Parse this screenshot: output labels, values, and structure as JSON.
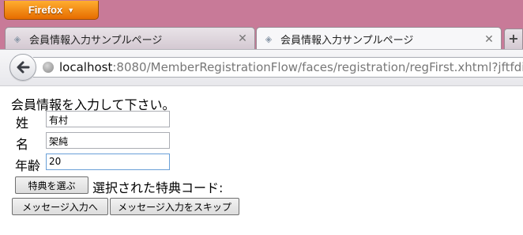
{
  "browser": {
    "app_button": "Firefox",
    "tabs": [
      {
        "title": "会員情報入力サンプルページ",
        "active": false
      },
      {
        "title": "会員情報入力サンプルページ",
        "active": true
      }
    ],
    "new_tab_symbol": "+",
    "url": {
      "host": "localhost",
      "rest": ":8080/MemberRegistrationFlow/faces/registration/regFirst.xhtml?jftfdi"
    }
  },
  "form": {
    "heading": "会員情報を入力して下さい。",
    "last_name": {
      "label": "姓",
      "value": "有村"
    },
    "first_name": {
      "label": "名",
      "value": "架純"
    },
    "age": {
      "label": "年齢",
      "value": "20"
    },
    "choose_benefit_button": "特典を選ぶ",
    "selected_code_label": "選択された特典コード:",
    "to_message_button": "メッセージ入力へ",
    "skip_message_button": "メッセージ入力をスキップ"
  },
  "colors": {
    "titlebar": "#c87a98",
    "firefox_button": "#f08a14",
    "focus_border": "#6aa0d8"
  }
}
